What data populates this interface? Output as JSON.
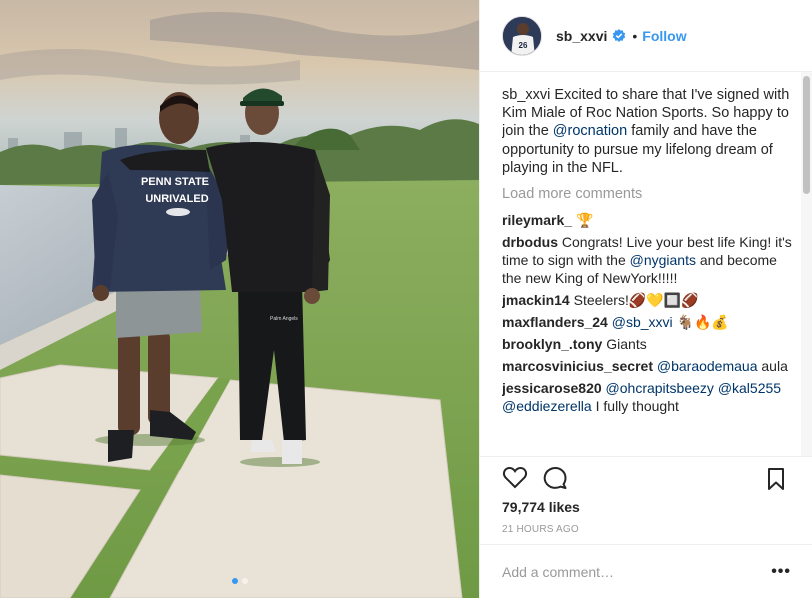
{
  "post": {
    "username": "sb_xxvi",
    "follow_label": "Follow",
    "separator": "•",
    "caption_user": "sb_xxvi",
    "caption_text_1": " Excited to share that I've signed with Kim Miale of Roc Nation Sports. So happy to join the ",
    "caption_mention": "@rocnation",
    "caption_text_2": " family and have the opportunity to pursue my lifelong dream of playing in the NFL.",
    "hoodie_line1": "PENN STATE",
    "hoodie_line2": "UNRIVALED",
    "pants_text": "Palm Angels",
    "jersey_number": "26"
  },
  "comments": {
    "load_more": "Load more comments",
    "items": [
      {
        "user": "rileymark_",
        "text": " 🏆"
      },
      {
        "user": "drbodus",
        "text": " Congrats! Live your best life King! it's time to sign with the ",
        "mention": "@nygiants",
        "text2": " and become the new King of NewYork!!!!!"
      },
      {
        "user": "jmackin14",
        "text": " Steelers!🏈💛🔲🏈"
      },
      {
        "user": "maxflanders_24",
        "text": " ",
        "mention": "@sb_xxvi",
        "text2": " 🐐🔥💰"
      },
      {
        "user": "brooklyn_.tony",
        "text": " Giants"
      },
      {
        "user": "marcosvinicius_secret",
        "text": " ",
        "mention": "@baraodemaua",
        "text2": " aula"
      },
      {
        "user": "jessicarose820",
        "text": " ",
        "mention": "@ohcrapitsbeezy",
        "text2": " ",
        "mention2": "@kal5255",
        "text3": " ",
        "mention3": "@eddiezerella",
        "text4": " I fully thought"
      }
    ]
  },
  "actions": {
    "likes": "79,774 likes",
    "time": "21 HOURS AGO"
  },
  "add_comment": {
    "placeholder": "Add a comment…",
    "more_label": "•••"
  },
  "icons": {
    "like": "heart-icon",
    "comment": "comment-icon",
    "save": "bookmark-icon",
    "verified": "verified-badge-icon"
  },
  "colors": {
    "link": "#3897f0",
    "mention": "#003569",
    "muted": "#999999"
  },
  "carousel": {
    "count": 2,
    "active_index": 0
  }
}
